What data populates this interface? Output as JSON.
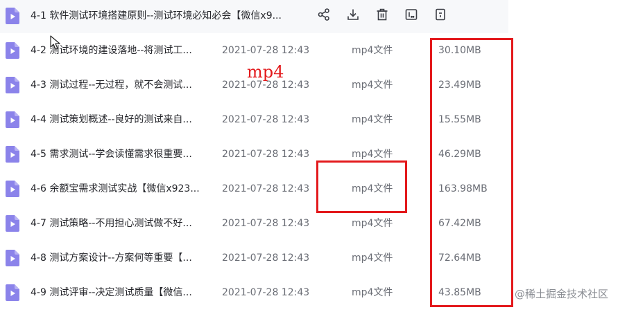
{
  "files": [
    {
      "name": "4-1 软件测试环境搭建原则--测试环境必知必会【微信x9...",
      "date": "",
      "type": "",
      "size": ""
    },
    {
      "name": "4-2 测试环境的建设落地--将测试工...",
      "date": "2021-07-28 12:43",
      "type": "mp4文件",
      "size": "30.10MB"
    },
    {
      "name": "4-3 测试过程--无过程，就不会测试...",
      "date": "2021-07-28 12:43",
      "type": "mp4文件",
      "size": "23.49MB"
    },
    {
      "name": "4-4 测试策划概述--良好的测试来自...",
      "date": "2021-07-28 12:43",
      "type": "mp4文件",
      "size": "15.55MB"
    },
    {
      "name": "4-5 需求测试--学会读懂需求很重要...",
      "date": "2021-07-28 12:43",
      "type": "mp4文件",
      "size": "46.29MB"
    },
    {
      "name": "4-6 余额宝需求测试实战【微信x923...",
      "date": "2021-07-28 12:43",
      "type": "mp4文件",
      "size": "163.98MB"
    },
    {
      "name": "4-7 测试策略--不用担心测试做不好...",
      "date": "2021-07-28 12:43",
      "type": "mp4文件",
      "size": "67.42MB"
    },
    {
      "name": "4-8 测试方案设计--方案何等重要【...",
      "date": "2021-07-28 12:43",
      "type": "mp4文件",
      "size": "72.64MB"
    },
    {
      "name": "4-9 测试评审--决定测试质量【微信...",
      "date": "2021-07-28 12:43",
      "type": "mp4文件",
      "size": "43.85MB"
    }
  ],
  "row_actions": [
    "share-icon",
    "download-icon",
    "delete-icon",
    "rename-icon",
    "more-icon"
  ],
  "annotation_text": "mp4",
  "watermark": "@稀土掘金技术社区",
  "colors": {
    "file_icon": "#8b83ea",
    "highlight": "#e3191c",
    "text_primary": "#25262b",
    "text_secondary": "#6a6d75"
  }
}
